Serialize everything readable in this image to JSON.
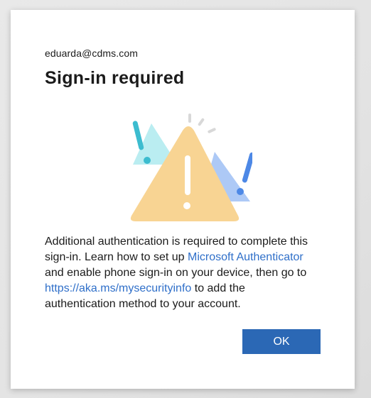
{
  "account": {
    "email": "eduarda@cdms.com"
  },
  "dialog": {
    "title": "Sign-in required",
    "illustration_icon": "warning-triangles-icon",
    "body": {
      "part1": "Additional authentication is required to complete this sign-in. Learn how to set up ",
      "link1": "Microsoft Authenticator",
      "part2": " and enable phone sign-in on your device, then go to ",
      "link2": "https://aka.ms/mysecurityinfo",
      "part3": " to add the authentication method to your account."
    },
    "ok_label": "OK"
  },
  "colors": {
    "accent": "#2b68b5",
    "link": "#2f6fc9",
    "warning_yellow": "#f8d493",
    "teal": "#3cbccf",
    "blue": "#4d88e6"
  }
}
